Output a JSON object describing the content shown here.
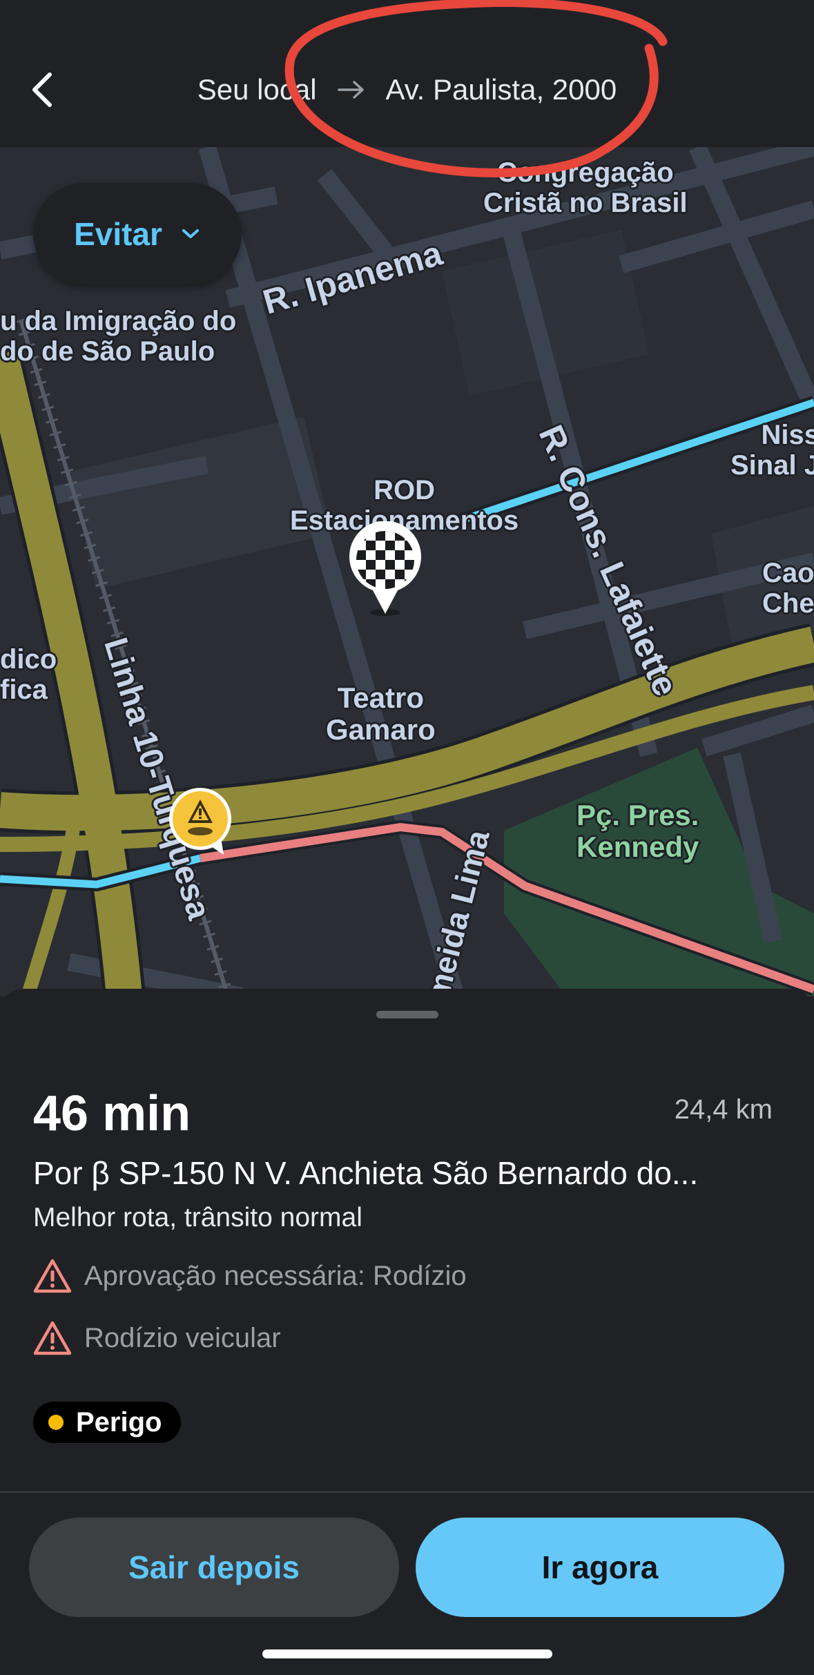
{
  "header": {
    "origin": "Seu local",
    "destination": "Av. Paulista, 2000"
  },
  "map": {
    "avoid_label": "Evitar",
    "labels": {
      "congregacao": "Congregação\nCristã no Brasil",
      "ipanema": "R. Ipanema",
      "imigracao": "u da Imigração do\ndo de São Paulo",
      "niss": "Niss\nSinal J",
      "rod": "ROD\nEstacionamentos",
      "lafaiette": "R. Cons. Lafaiette",
      "cao": "Cao\nChe",
      "dico": "dico\nfica",
      "linha10": "Linha 10-Turquesa",
      "teatro": "Teatro\nGamaro",
      "lima": "meida Lima",
      "praca": "Pç. Pres.\nKennedy"
    }
  },
  "route": {
    "eta": "46 min",
    "distance": "24,4 km",
    "via": "Por β SP-150 N V. Anchieta São Bernardo do...",
    "summary": "Melhor rota, trânsito normal",
    "warnings": [
      "Aprovação necessária: Rodízio",
      "Rodízio veicular"
    ],
    "badge": "Perigo"
  },
  "actions": {
    "leave_later": "Sair depois",
    "go_now": "Ir agora"
  },
  "colors": {
    "accent_blue": "#5ec7fa",
    "go_button": "#66c8f8",
    "annotation_red": "#e8473b",
    "warning_icon": "#f28b82",
    "danger_dot": "#fbbc04",
    "highway": "#8f8a3a",
    "route_traffic": "#e88080",
    "route_blue": "#5bd2f5",
    "park": "#2a4a39"
  },
  "icons": [
    "back-arrow-icon",
    "arrow-right-icon",
    "chevron-down-icon",
    "checkered-flag-pin-icon",
    "hazard-pin-icon",
    "warning-triangle-icon"
  ]
}
